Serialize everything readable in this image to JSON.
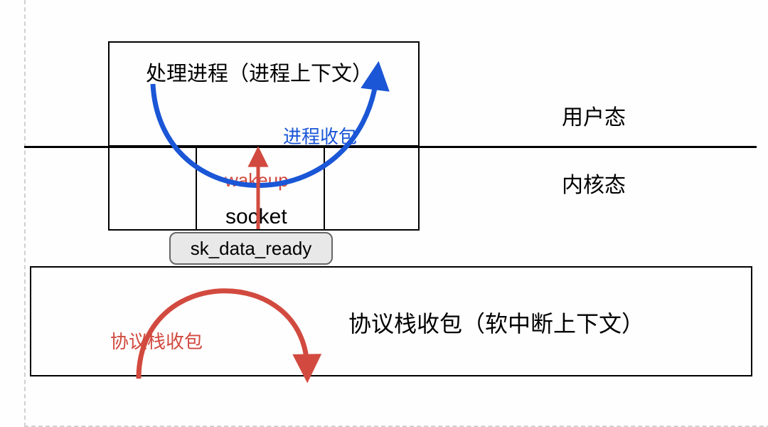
{
  "labels": {
    "process_box_title": "处理进程（进程上下文）",
    "user_space": "用户态",
    "kernel_space": "内核态",
    "process_recv": "进程收包",
    "wakeup": "wakeup",
    "socket": "socket",
    "sk_data_ready": "sk_data_ready",
    "protocol_recv_arrow": "协议栈收包",
    "protocol_box_title": "协议栈收包（软中断上下文）"
  },
  "colors": {
    "blue": "#1a56d6",
    "red": "#d24a3f",
    "grey_fill": "#e8e8e8"
  }
}
